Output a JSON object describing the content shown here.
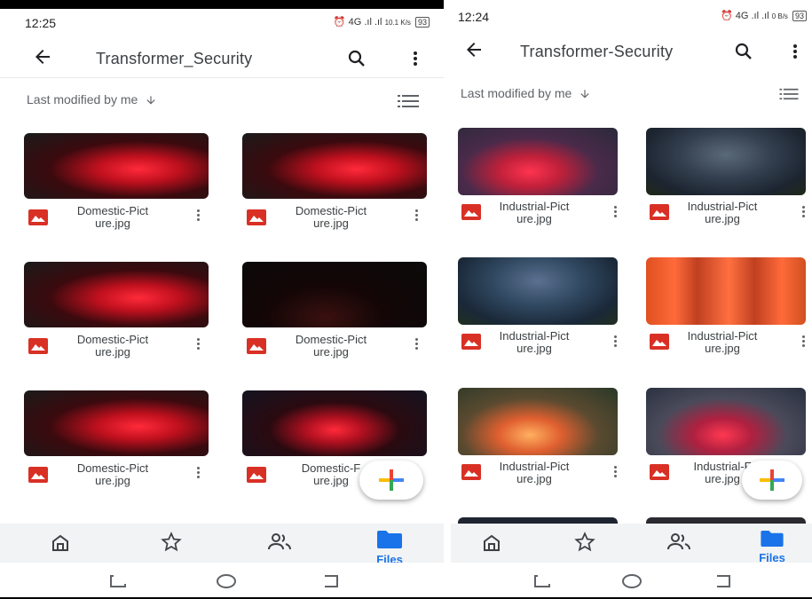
{
  "left_screen": {
    "status_time": "12:25",
    "status_icons": "⏰ 4G .ıl .ıl",
    "status_speed": "10.1 K/s",
    "battery": "93",
    "title": "Transformer_Security",
    "sort_label": "Last modified by me",
    "files": [
      {
        "name_line1": "Domestic-Pict",
        "name_line2": "ure.jpg"
      },
      {
        "name_line1": "Domestic-Pict",
        "name_line2": "ure.jpg"
      },
      {
        "name_line1": "Domestic-Pict",
        "name_line2": "ure.jpg"
      },
      {
        "name_line1": "Domestic-Pict",
        "name_line2": "ure.jpg"
      },
      {
        "name_line1": "Domestic-Pict",
        "name_line2": "ure.jpg"
      },
      {
        "name_line1": "Domestic-F",
        "name_line2": "ure.jpg"
      }
    ],
    "nav_files_label": "Files"
  },
  "right_screen": {
    "status_time": "12:24",
    "status_icons": "⏰ 4G .ıl .ıl",
    "status_speed": "0 B/s",
    "battery": "93",
    "title": "Transformer-Security",
    "sort_label": "Last modified by me",
    "files": [
      {
        "name_line1": "Industrial-Pict",
        "name_line2": "ure.jpg"
      },
      {
        "name_line1": "Industrial-Pict",
        "name_line2": "ure.jpg"
      },
      {
        "name_line1": "Industrial-Pict",
        "name_line2": "ure.jpg"
      },
      {
        "name_line1": "Industrial-Pict",
        "name_line2": "ure.jpg"
      },
      {
        "name_line1": "Industrial-Pict",
        "name_line2": "ure.jpg"
      },
      {
        "name_line1": "Industrial-F",
        "name_line2": "ure.jpg"
      }
    ],
    "nav_files_label": "Files"
  },
  "colors": {
    "accent_blue": "#1a73e8",
    "image_icon_red": "#d93025",
    "google_red": "#ea4335",
    "google_blue": "#4285f4",
    "google_yellow": "#fbbc04",
    "google_green": "#34a853"
  },
  "icons": [
    "arrow-back-icon",
    "search-icon",
    "more-vert-icon",
    "arrow-down-icon",
    "list-view-icon",
    "image-file-icon",
    "home-icon",
    "star-icon",
    "shared-people-icon",
    "folder-icon",
    "plus-icon"
  ]
}
